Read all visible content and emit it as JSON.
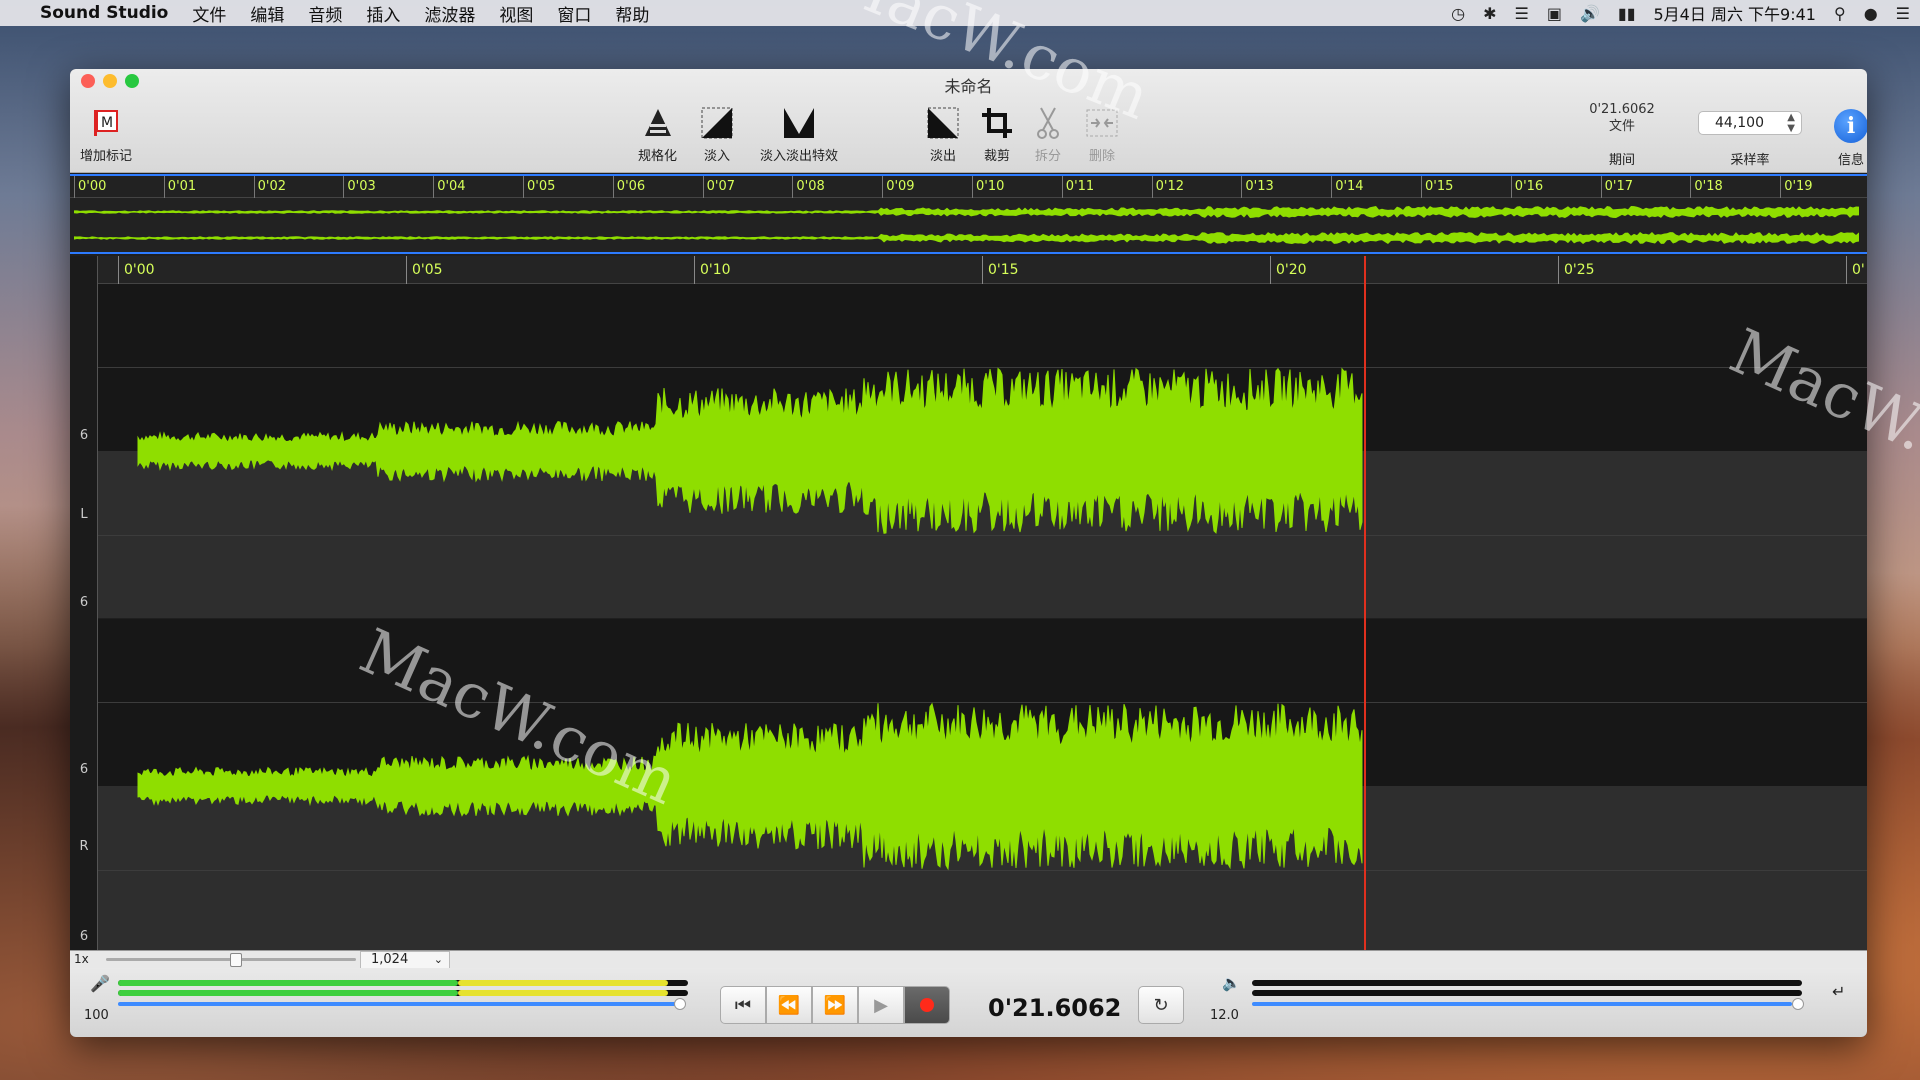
{
  "menubar": {
    "app_name": "Sound Studio",
    "menus": [
      "文件",
      "编辑",
      "音频",
      "插入",
      "滤波器",
      "视图",
      "窗口",
      "帮助"
    ],
    "clock": "5月4日 周六 下午9:41"
  },
  "window": {
    "title": "未命名",
    "toolbar": {
      "add_marker": "增加标记",
      "normalize": "规格化",
      "fade_in": "淡入",
      "crossfade": "淡入淡出特效",
      "fade_out": "淡出",
      "crop": "裁剪",
      "split": "拆分",
      "delete": "删除",
      "duration_value": "0'21.6062",
      "duration_sub": "文件",
      "duration_label": "期间",
      "sample_rate_value": "44,100",
      "sample_rate_label": "采样率",
      "info_label": "信息"
    }
  },
  "overview": {
    "ticks": [
      "0'00",
      "0'01",
      "0'02",
      "0'03",
      "0'04",
      "0'05",
      "0'06",
      "0'07",
      "0'08",
      "0'09",
      "0'10",
      "0'11",
      "0'12",
      "0'13",
      "0'14",
      "0'15",
      "0'16",
      "0'17",
      "0'18",
      "0'19"
    ]
  },
  "ruler": {
    "ticks": [
      "0'00",
      "0'05",
      "0'10",
      "0'15",
      "0'20",
      "0'25",
      "0'"
    ]
  },
  "channels": {
    "left_label": "L",
    "right_label": "R",
    "db_mark": "6"
  },
  "zoom": {
    "factor": "1x",
    "samples": "1,024"
  },
  "transport": {
    "input_level": "100",
    "output_level": "12.0",
    "timecode": "0'21.6062"
  },
  "watermark": "MacW.com",
  "colors": {
    "waveform": "#8fde00",
    "playhead": "#e0301e",
    "selection": "#2d7bff"
  }
}
